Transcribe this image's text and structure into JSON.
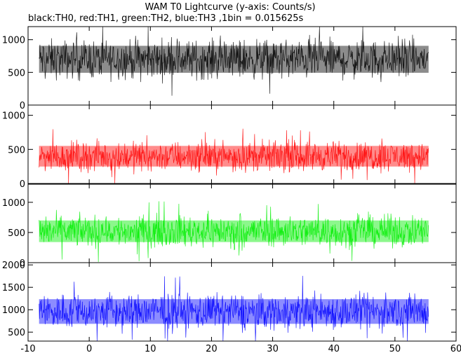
{
  "chart_data": {
    "type": "line",
    "title": "WAM T0 Lightcurve (y-axis: Counts/s)",
    "subtitle": "black:TH0, red:TH1, green:TH2, blue:TH3 ,1bin = 0.015625s",
    "xlim": [
      -10,
      60
    ],
    "x_ticks": [
      -10,
      0,
      10,
      20,
      30,
      40,
      50,
      60
    ],
    "x_data_range": [
      -8.2,
      55.5
    ],
    "bin_seconds": 0.015625,
    "grid": false,
    "panels": [
      {
        "name": "TH0",
        "color": "#000000",
        "ylim": [
          0,
          1200
        ],
        "y_ticks": [
          0,
          500,
          1000
        ],
        "band": {
          "low": 300,
          "high": 1050,
          "mean": 700
        }
      },
      {
        "name": "TH1",
        "color": "#ff0000",
        "ylim": [
          0,
          1150
        ],
        "y_ticks": [
          0,
          500,
          1000
        ],
        "band": {
          "low": 150,
          "high": 700,
          "mean": 400
        }
      },
      {
        "name": "TH2",
        "color": "#00ee00",
        "ylim": [
          0,
          1300
        ],
        "y_ticks": [
          0,
          500,
          1000
        ],
        "band": {
          "low": 200,
          "high": 850,
          "mean": 520
        }
      },
      {
        "name": "TH3",
        "color": "#0000ff",
        "ylim": [
          300,
          2050
        ],
        "y_ticks": [
          500,
          1000,
          1500,
          2000
        ],
        "band": {
          "low": 500,
          "high": 1500,
          "mean": 960
        }
      }
    ]
  }
}
